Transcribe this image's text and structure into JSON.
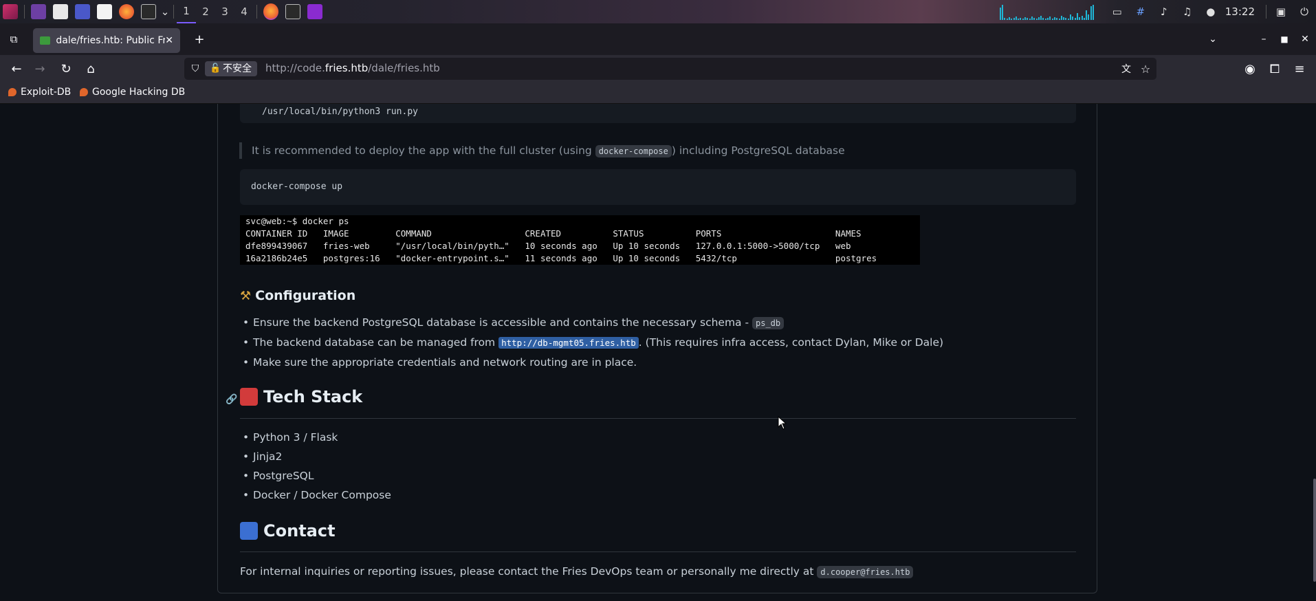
{
  "taskbar": {
    "workspaces": [
      "1",
      "2",
      "3",
      "4"
    ],
    "clock": "13:22"
  },
  "browser": {
    "tab_title": "dale/fries.htb: Public Fries",
    "security_label": "不安全",
    "url_prefix": "http://code.",
    "url_domain": "fries.htb",
    "url_path": "/dale/fries.htb",
    "bookmarks": [
      "Exploit-DB",
      "Google Hacking DB"
    ]
  },
  "readme": {
    "run_command": "/usr/local/bin/python3 run.py",
    "quote_before": "It is recommended to deploy the app with the full cluster (using ",
    "quote_code": "docker-compose",
    "quote_after": ") including PostgreSQL database",
    "compose_command": "docker-compose up",
    "terminal_lines": [
      "svc@web:~$ docker ps",
      "CONTAINER ID   IMAGE         COMMAND                  CREATED          STATUS          PORTS                      NAMES",
      "dfe899439067   fries-web     \"/usr/local/bin/pyth…\"   10 seconds ago   Up 10 seconds   127.0.0.1:5000->5000/tcp   web",
      "16a2186b24e5   postgres:16   \"docker-entrypoint.s…\"   11 seconds ago   Up 10 seconds   5432/tcp                   postgres"
    ],
    "config_heading": "Configuration",
    "config_items": {
      "item1_text": "Ensure the backend PostgreSQL database is accessible and contains the necessary schema - ",
      "item1_code": "ps_db",
      "item2_before": "The backend database can be managed from ",
      "item2_link": "http://db-mgmt05.fries.htb",
      "item2_after": ". (This requires infra access, contact Dylan, Mike or Dale)",
      "item3_text": "Make sure the appropriate credentials and network routing are in place."
    },
    "techstack_heading": "Tech Stack",
    "techstack_items": [
      "Python 3 / Flask",
      "Jinja2",
      "PostgreSQL",
      "Docker / Docker Compose"
    ],
    "contact_heading": "Contact",
    "contact_text": "For internal inquiries or reporting issues, please contact the Fries DevOps team or personally me directly at ",
    "contact_email": "d.cooper@fries.htb"
  },
  "colors": {
    "page_bg": "#0d1117",
    "selection": "#2f5fa3",
    "terminal_bg": "#000000"
  }
}
